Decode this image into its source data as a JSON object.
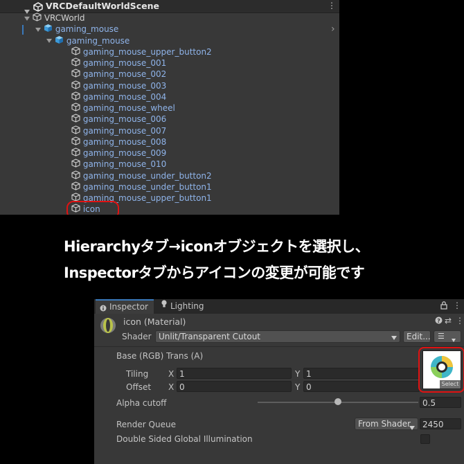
{
  "hierarchy": {
    "scene": "VRCDefaultWorldScene",
    "items": [
      {
        "label": "VRCWorld",
        "color": "w"
      },
      {
        "label": "gaming_mouse",
        "color": "b"
      },
      {
        "label": "gaming_mouse",
        "color": "b"
      },
      {
        "label": "gaming_mouse_upper_button2",
        "color": "b"
      },
      {
        "label": "gaming_mouse_001",
        "color": "b"
      },
      {
        "label": "gaming_mouse_002",
        "color": "b"
      },
      {
        "label": "gaming_mouse_003",
        "color": "b"
      },
      {
        "label": "gaming_mouse_004",
        "color": "b"
      },
      {
        "label": "gaming_mouse_wheel",
        "color": "b"
      },
      {
        "label": "gaming_mouse_006",
        "color": "b"
      },
      {
        "label": "gaming_mouse_007",
        "color": "b"
      },
      {
        "label": "gaming_mouse_008",
        "color": "b"
      },
      {
        "label": "gaming_mouse_009",
        "color": "b"
      },
      {
        "label": "gaming_mouse_010",
        "color": "b"
      },
      {
        "label": "gaming_mouse_under_button2",
        "color": "b"
      },
      {
        "label": "gaming_mouse_under_button1",
        "color": "b"
      },
      {
        "label": "gaming_mouse_upper_button1",
        "color": "b"
      },
      {
        "label": "icon",
        "color": "b"
      }
    ]
  },
  "caption": {
    "line1": "Hierarchyタブ→iconオブジェクトを選択し、",
    "line2": "Inspectorタブからアイコンの変更が可能です"
  },
  "inspector": {
    "tab_inspector": "Inspector",
    "tab_lighting": "Lighting",
    "material_name": "icon (Material)",
    "shader_label": "Shader",
    "shader_value": "Unlit/Transparent Cutout",
    "edit_button": "Edit...",
    "base_label": "Base (RGB) Trans (A)",
    "tiling_label": "Tiling",
    "offset_label": "Offset",
    "x_label": "X",
    "y_label": "Y",
    "tiling_x": "1",
    "tiling_y": "1",
    "offset_x": "0",
    "offset_y": "0",
    "select_label": "Select",
    "alpha_cutoff_label": "Alpha cutoff",
    "alpha_cutoff_value": "0.5",
    "alpha_cutoff_fraction": 0.5,
    "render_queue_label": "Render Queue",
    "render_queue_mode": "From Shader",
    "render_queue_value": "2450",
    "double_sided_label": "Double Sided Global Illumination"
  },
  "colors": {
    "highlight": "#e01212",
    "item_blue": "#8fb4ea",
    "tab_accent": "#3a79bb"
  }
}
